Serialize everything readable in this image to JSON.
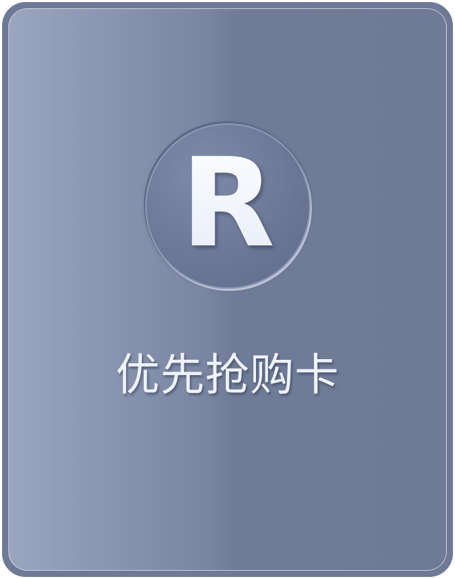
{
  "card": {
    "badge_letter": "R",
    "title": "优先抢购卡"
  }
}
